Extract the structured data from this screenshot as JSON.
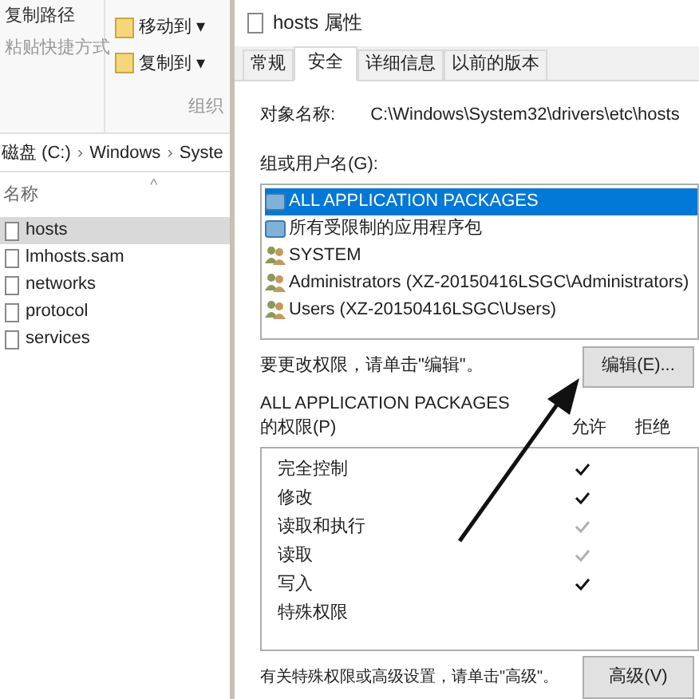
{
  "explorer": {
    "ribbon": {
      "clipboard": [
        "复制路径",
        "粘贴快捷方式"
      ],
      "organize": [
        {
          "label": "移动到",
          "caret": "▾"
        },
        {
          "label": "复制到",
          "caret": "▾"
        }
      ],
      "group_label": "组织"
    },
    "address": [
      {
        "label": "磁盘 (C:)"
      },
      {
        "separator": "›",
        "label": "Windows"
      },
      {
        "separator": "›",
        "label": "Syste"
      }
    ],
    "column": {
      "label": "名称",
      "sort": "^"
    },
    "files": [
      {
        "name": "hosts",
        "selected": true
      },
      {
        "name": "lmhosts.sam",
        "selected": false
      },
      {
        "name": "networks",
        "selected": false
      },
      {
        "name": "protocol",
        "selected": false
      },
      {
        "name": "services",
        "selected": false
      }
    ]
  },
  "dialog": {
    "title": "hosts 属性",
    "tabs": [
      {
        "label": "常规",
        "selected": false
      },
      {
        "label": "安全",
        "selected": true
      },
      {
        "label": "详细信息",
        "selected": false
      },
      {
        "label": "以前的版本",
        "selected": false
      }
    ],
    "object_label": "对象名称:",
    "object_value": "C:\\Windows\\System32\\drivers\\etc\\hosts",
    "groups_label": "组或用户名(G):",
    "groups": [
      {
        "name": "ALL APPLICATION PACKAGES",
        "kind": "package",
        "selected": true
      },
      {
        "name": "所有受限制的应用程序包",
        "kind": "package",
        "selected": false
      },
      {
        "name": "SYSTEM",
        "kind": "user",
        "selected": false
      },
      {
        "name": "Administrators (XZ-20150416LSGC\\Administrators)",
        "kind": "user",
        "selected": false
      },
      {
        "name": "Users (XZ-20150416LSGC\\Users)",
        "kind": "user",
        "selected": false
      }
    ],
    "change_hint": "要更改权限，请单击\"编辑\"。",
    "edit_button": "编辑(E)...",
    "perm_for": "ALL APPLICATION PACKAGES",
    "perm_label": "的权限(P)",
    "allow_header": "允许",
    "deny_header": "拒绝",
    "permissions": [
      {
        "name": "完全控制",
        "allow": true,
        "inherited": false
      },
      {
        "name": "修改",
        "allow": true,
        "inherited": false
      },
      {
        "name": "读取和执行",
        "allow": true,
        "inherited": true
      },
      {
        "name": "读取",
        "allow": true,
        "inherited": true
      },
      {
        "name": "写入",
        "allow": true,
        "inherited": false
      },
      {
        "name": "特殊权限",
        "allow": false
      }
    ],
    "advanced_hint": "有关特殊权限或高级设置，请单击\"高级\"。",
    "advanced_button": "高级(V)"
  }
}
